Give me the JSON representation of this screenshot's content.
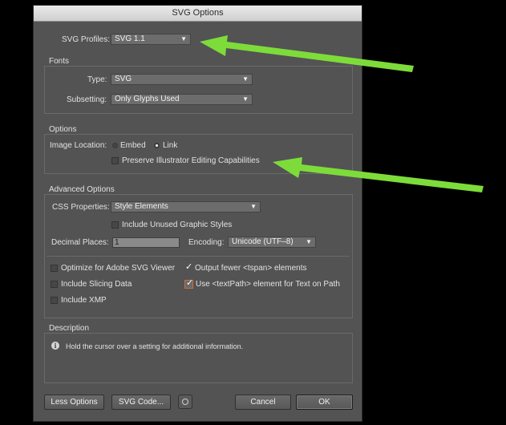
{
  "window": {
    "title": "SVG Options"
  },
  "profiles": {
    "label": "SVG Profiles:",
    "value": "SVG 1.1"
  },
  "fonts": {
    "legend": "Fonts",
    "type_label": "Type:",
    "type_value": "SVG",
    "subsetting_label": "Subsetting:",
    "subsetting_value": "Only Glyphs Used"
  },
  "options": {
    "legend": "Options",
    "image_location_label": "Image Location:",
    "embed_label": "Embed",
    "link_label": "Link",
    "preserve_label": "Preserve Illustrator Editing Capabilities"
  },
  "advanced": {
    "legend": "Advanced Options",
    "css_label": "CSS Properties:",
    "css_value": "Style Elements",
    "unused_styles_label": "Include Unused Graphic Styles",
    "decimal_label": "Decimal Places:",
    "decimal_value": "1",
    "encoding_label": "Encoding:",
    "encoding_value": "Unicode (UTF–8)",
    "optimize_label": "Optimize for Adobe SVG Viewer",
    "fewer_tspan_label": "Output fewer <tspan> elements",
    "slicing_label": "Include Slicing Data",
    "textpath_label": "Use <textPath> element for Text on Path",
    "xmp_label": "Include XMP"
  },
  "description": {
    "legend": "Description",
    "text": "Hold the cursor over a setting for additional information."
  },
  "buttons": {
    "less_options": "Less Options",
    "svg_code": "SVG Code...",
    "cancel": "Cancel",
    "ok": "OK"
  },
  "colors": {
    "arrow": "#7ddc3a",
    "dialog_bg": "#535353"
  }
}
